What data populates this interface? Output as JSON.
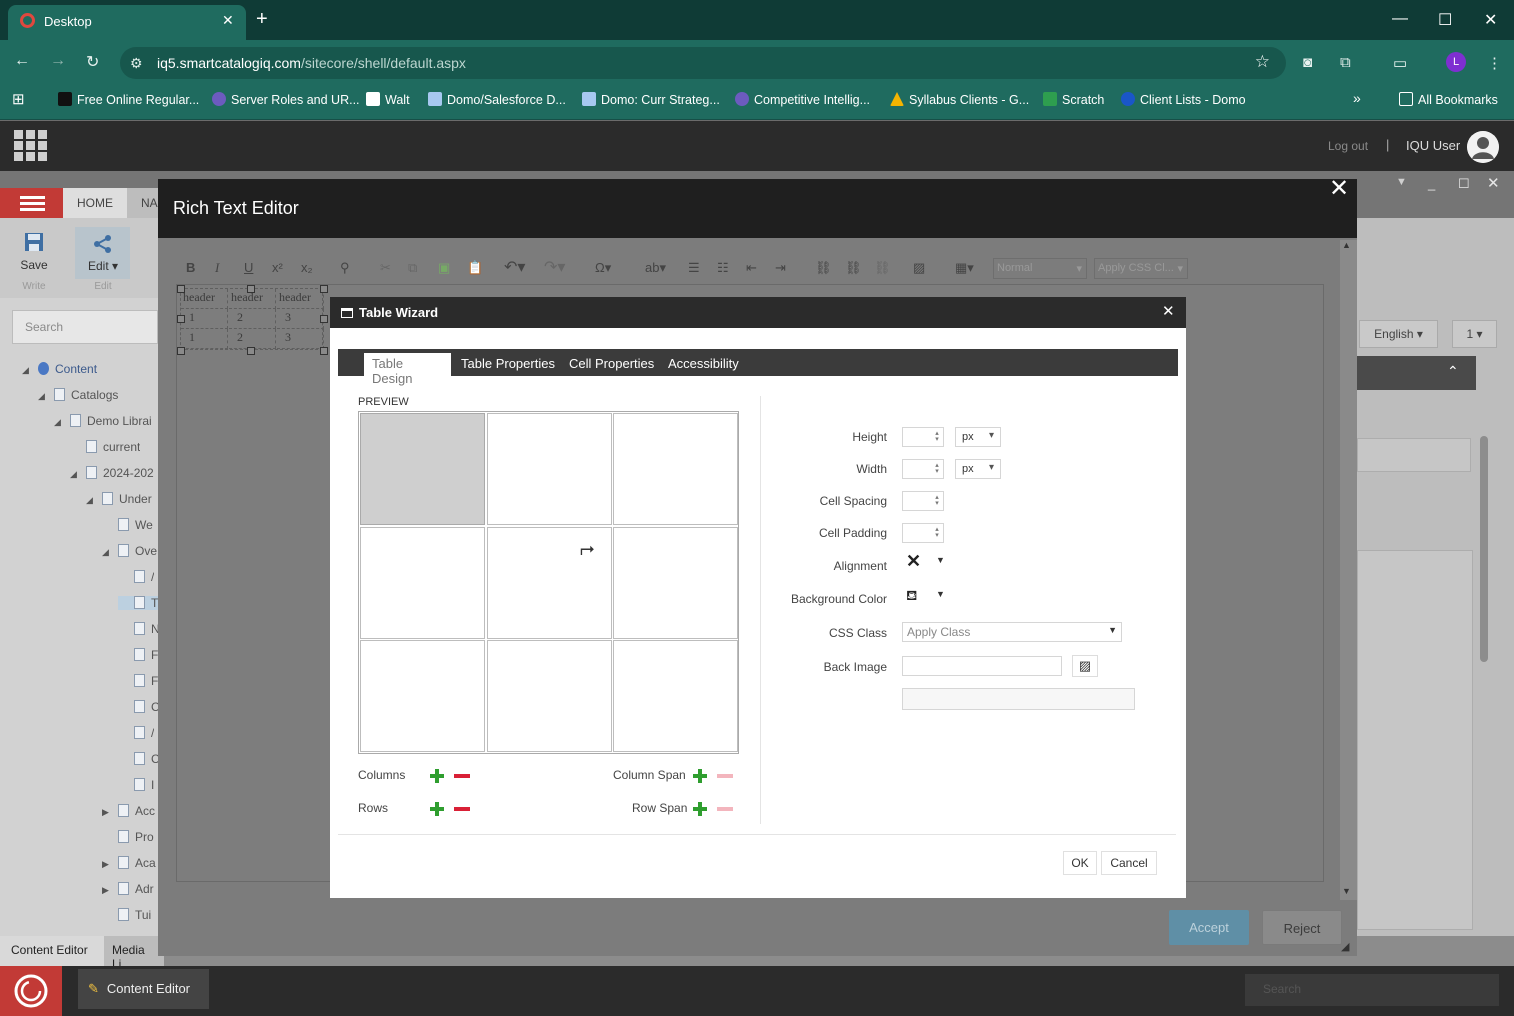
{
  "browser": {
    "tab_title": "Desktop",
    "url_host": "iq5.smartcatalogiq.com",
    "url_path": "/sitecore/shell/default.aspx",
    "profile_initial": "L",
    "bookmarks": [
      "Free Online Regular...",
      "Server Roles and UR...",
      "Walt",
      "Domo/Salesforce D...",
      "Domo: Curr Strateg...",
      "Competitive Intellig...",
      "Syllabus Clients - G...",
      "Scratch",
      "Client Lists - Domo"
    ],
    "all_bookmarks": "All Bookmarks",
    "bookmarks_overflow": "»"
  },
  "sitecore": {
    "logout": "Log out",
    "separator": "|",
    "user_name": "IQU User",
    "ribbon_tabs": [
      "HOME",
      "NA"
    ],
    "save_label": "Save",
    "write_label": "Write",
    "edit_label": "Edit ▾",
    "edit_group": "Edit",
    "search_placeholder": "Search",
    "language": "English ▾",
    "version": "1 ▾",
    "tree": [
      {
        "label": "Content",
        "level": 0,
        "arrow": "◢"
      },
      {
        "label": "Catalogs",
        "level": 1,
        "arrow": "◢"
      },
      {
        "label": "Demo Librai",
        "level": 2,
        "arrow": "◢"
      },
      {
        "label": "current",
        "level": 3,
        "arrow": ""
      },
      {
        "label": "2024-202",
        "level": 3,
        "arrow": "◢"
      },
      {
        "label": "Under",
        "level": 4,
        "arrow": "◢"
      },
      {
        "label": "We",
        "level": 5,
        "arrow": ""
      },
      {
        "label": "Ove",
        "level": 5,
        "arrow": "◢"
      },
      {
        "label": "/",
        "level": 6,
        "arrow": ""
      },
      {
        "label": "T",
        "level": 6,
        "arrow": ""
      },
      {
        "label": "N",
        "level": 6,
        "arrow": ""
      },
      {
        "label": "F",
        "level": 6,
        "arrow": ""
      },
      {
        "label": "F",
        "level": 6,
        "arrow": ""
      },
      {
        "label": "C",
        "level": 6,
        "arrow": ""
      },
      {
        "label": "/",
        "level": 6,
        "arrow": ""
      },
      {
        "label": "C",
        "level": 6,
        "arrow": ""
      },
      {
        "label": "I",
        "level": 6,
        "arrow": ""
      },
      {
        "label": "Acc",
        "level": 5,
        "arrow": "▶"
      },
      {
        "label": "Pro",
        "level": 5,
        "arrow": ""
      },
      {
        "label": "Aca",
        "level": 5,
        "arrow": "▶"
      },
      {
        "label": "Adr",
        "level": 5,
        "arrow": "▶"
      },
      {
        "label": "Tui",
        "level": 5,
        "arrow": ""
      }
    ],
    "bottom_tabs": [
      "Content Editor",
      "Media Li"
    ],
    "taskbar_item": "Content Editor",
    "taskbar_search": "Search"
  },
  "rte": {
    "title": "Rich Text Editor",
    "close": "✕",
    "paragraph_style": "Normal",
    "css_class": "Apply CSS Cl...",
    "content_table": [
      [
        "header",
        "header",
        "header"
      ],
      [
        "1",
        "2",
        "3"
      ],
      [
        "1",
        "2",
        "3"
      ]
    ],
    "accept": "Accept",
    "reject": "Reject"
  },
  "table_wizard": {
    "title": "Table Wizard",
    "close": "✕",
    "tabs": [
      "Table Design",
      "Table Properties",
      "Cell Properties",
      "Accessibility"
    ],
    "active_tab": "Table Design",
    "preview_label": "PREVIEW",
    "preview_rows": 3,
    "preview_cols": 3,
    "columns_label": "Columns",
    "rows_label": "Rows",
    "column_span_label": "Column Span",
    "row_span_label": "Row Span",
    "height_label": "Height",
    "width_label": "Width",
    "height_unit": "px",
    "width_unit": "px",
    "cell_spacing_label": "Cell Spacing",
    "cell_padding_label": "Cell Padding",
    "alignment_label": "Alignment",
    "background_color_label": "Background Color",
    "css_class_label": "CSS Class",
    "css_class_value": "Apply Class",
    "back_image_label": "Back Image",
    "ok": "OK",
    "cancel": "Cancel"
  },
  "colors": {
    "chrome_dark": "#0f3b36",
    "chrome_teal": "#1f6b5f",
    "sitecore_red": "#c23a36",
    "accept_blue": "#5f8fa6",
    "add_green": "#2f9e2f",
    "remove_red": "#d92036"
  }
}
